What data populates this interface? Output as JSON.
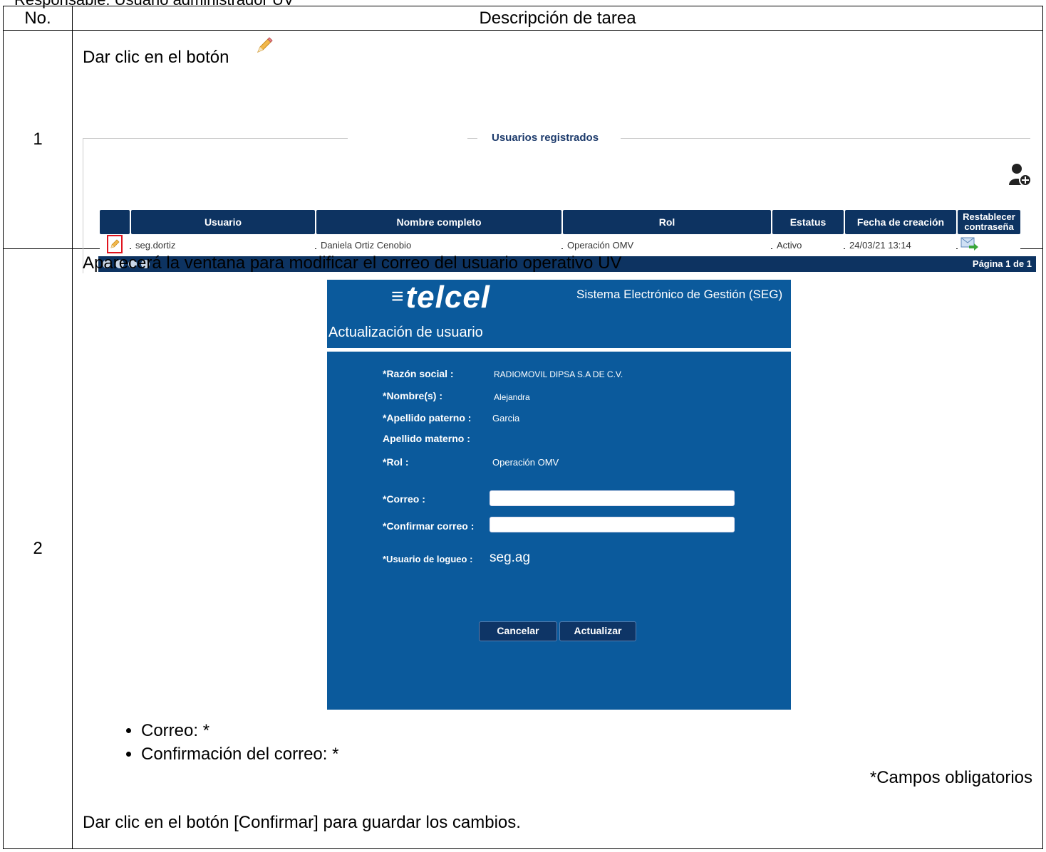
{
  "top_clip": "Responsable: Usuario administrador UV",
  "table": {
    "col_no": "No.",
    "col_desc": "Descripción de tarea"
  },
  "step1": {
    "number": "1",
    "instruction": "Dar clic en el botón",
    "panel_title": "Usuarios registrados",
    "columns": [
      "Usuario",
      "Nombre completo",
      "Rol",
      "Estatus",
      "Fecha de creación",
      "Restablecer contraseña"
    ],
    "row": {
      "usuario": "seg.dortiz",
      "nombre": "Daniela Ortiz Cenobio",
      "rol": "Operación OMV",
      "estatus": "Activo",
      "fecha": "24/03/21 13:14"
    },
    "pager_label": "Página 1 de 1",
    "icons": [
      "pencil-icon",
      "add-user-icon",
      "mail-forward-icon",
      "first-page-icon",
      "prev-page-icon",
      "next-page-icon",
      "last-page-icon"
    ]
  },
  "step2": {
    "number": "2",
    "intro": "Aparecerá la ventana para modificar el correo del usuario operativo UV",
    "dialog": {
      "brand": "telcel",
      "brand_sub": "Sistema Electrónico de Gestión (SEG)",
      "title": "Actualización de usuario",
      "fields": {
        "razon_label": "*Razón social :",
        "razon_value": "RADIOMOVIL DIPSA S.A DE C.V.",
        "nombre_label": "*Nombre(s) :",
        "nombre_value": "Alejandra",
        "paterno_label": "*Apellido paterno :",
        "paterno_value": "Garcia",
        "materno_label": "Apellido materno :",
        "rol_label": "*Rol :",
        "rol_value": "Operación OMV",
        "correo_label": "*Correo :",
        "correo_value": "",
        "confirmar_label": "*Confirmar correo :",
        "confirmar_value": "",
        "logueo_label": "*Usuario de logueo :",
        "logueo_value": "seg.ag"
      },
      "cancel_label": "Cancelar",
      "update_label": "Actualizar"
    },
    "required_items": [
      "Correo: *",
      "Confirmación del correo: *"
    ],
    "required_note": "*Campos obligatorios",
    "final_instruction": "Dar clic en el botón  [Confirmar] para guardar los cambios."
  },
  "colors": {
    "grid_header": "#0d3361",
    "dialog_bg": "#0b5a9c",
    "highlight": "#e0141e"
  }
}
